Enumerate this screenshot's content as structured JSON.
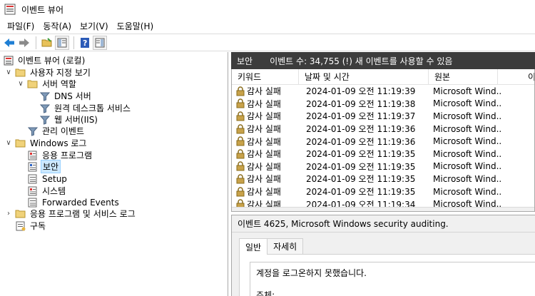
{
  "window": {
    "title": "이벤트 뷰어"
  },
  "menu": [
    "파일(F)",
    "동작(A)",
    "보기(V)",
    "도움말(H)"
  ],
  "toolbar": {
    "icons": [
      "back-arrow-icon",
      "forward-arrow-icon",
      "open-folder-icon",
      "properties-icon",
      "help-icon",
      "show-hide-action-pane-icon"
    ]
  },
  "tree": {
    "root": "이벤트 뷰어 (로컬)",
    "custom_views": "사용자 지정 보기",
    "server_roles": "서버 역할",
    "dns": "DNS 서버",
    "rds": "원격 데스크톱 서비스",
    "iis": "웹 서버(IIS)",
    "admin_events": "관리 이벤트",
    "windows_logs": "Windows 로그",
    "application": "응용 프로그램",
    "security": "보안",
    "setup": "Setup",
    "system": "시스템",
    "forwarded": "Forwarded Events",
    "apps_services": "응용 프로그램 및 서비스 로그",
    "subscriptions": "구독"
  },
  "list": {
    "log_name": "보안",
    "count_text": "이벤트 수: 34,755 (!) 새 이벤트를 사용할 수 있음",
    "columns": [
      "키워드",
      "날짜 및 시간",
      "원본",
      "이"
    ],
    "rows": [
      {
        "keyword": "감사 실패",
        "datetime": "2024-01-09 오전 11:19:39",
        "source": "Microsoft Wind..."
      },
      {
        "keyword": "감사 실패",
        "datetime": "2024-01-09 오전 11:19:38",
        "source": "Microsoft Wind..."
      },
      {
        "keyword": "감사 실패",
        "datetime": "2024-01-09 오전 11:19:37",
        "source": "Microsoft Wind..."
      },
      {
        "keyword": "감사 실패",
        "datetime": "2024-01-09 오전 11:19:36",
        "source": "Microsoft Wind..."
      },
      {
        "keyword": "감사 실패",
        "datetime": "2024-01-09 오전 11:19:36",
        "source": "Microsoft Wind..."
      },
      {
        "keyword": "감사 실패",
        "datetime": "2024-01-09 오전 11:19:35",
        "source": "Microsoft Wind..."
      },
      {
        "keyword": "감사 실패",
        "datetime": "2024-01-09 오전 11:19:35",
        "source": "Microsoft Wind..."
      },
      {
        "keyword": "감사 실패",
        "datetime": "2024-01-09 오전 11:19:35",
        "source": "Microsoft Wind..."
      },
      {
        "keyword": "감사 실패",
        "datetime": "2024-01-09 오전 11:19:35",
        "source": "Microsoft Wind..."
      },
      {
        "keyword": "감사 실패",
        "datetime": "2024-01-09 오전 11:19:34",
        "source": "Microsoft Wind..."
      }
    ]
  },
  "detail": {
    "title": "이벤트 4625, Microsoft Windows security auditing.",
    "tabs": [
      "일반",
      "자세히"
    ],
    "message": "계정을 로그온하지 못했습니다.",
    "subject_label": "주체:"
  },
  "colors": {
    "header_bar": "#3c3c3c",
    "selection": "#cce8ff",
    "lock": "#c8a24a"
  }
}
